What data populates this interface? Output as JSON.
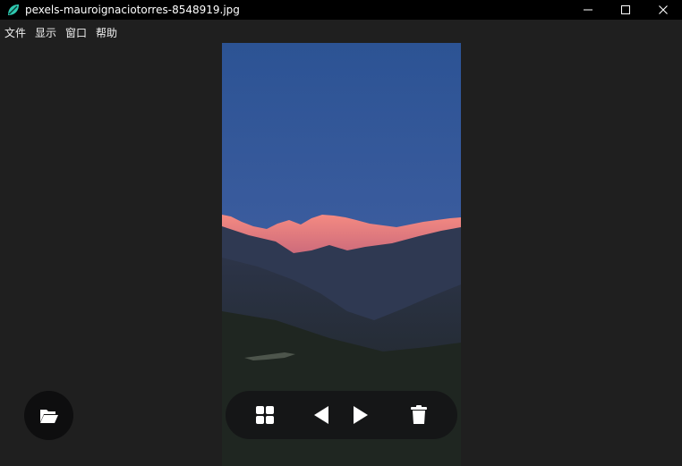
{
  "window": {
    "title": "pexels-mauroignaciotorres-8548919.jpg",
    "app_icon": "leaf-app-icon",
    "controls": [
      "minimize-icon",
      "maximize-icon",
      "close-icon"
    ]
  },
  "menu": {
    "items": [
      {
        "label": "文件"
      },
      {
        "label": "显示"
      },
      {
        "label": "窗口"
      },
      {
        "label": "帮助"
      }
    ]
  },
  "viewer": {
    "image_subject": "mountain range at sunset under blue sky",
    "toolbar_icons": [
      "grid-icon",
      "previous-icon",
      "next-icon",
      "trash-icon"
    ],
    "open_button_icon": "folder-open-icon"
  },
  "colors": {
    "background": "#1f1f1f",
    "titlebar": "#000000",
    "sky_top": "#2e5596",
    "sky_bottom": "#4a66a8",
    "peaks": "#f07a72",
    "toolbar": "#141416"
  }
}
